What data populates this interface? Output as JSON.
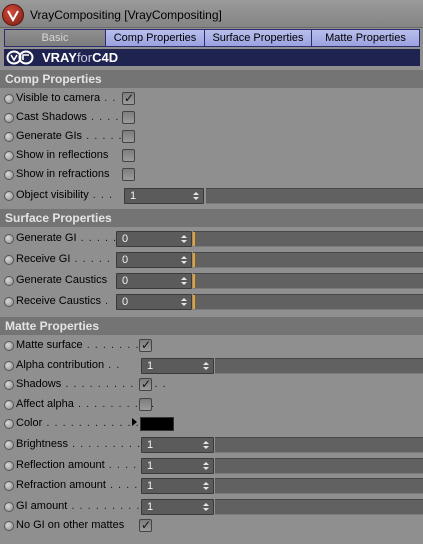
{
  "window": {
    "title": "VrayCompositing [VrayCompositing]"
  },
  "tabs": [
    {
      "label": "Basic",
      "active": true
    },
    {
      "label": "Comp Properties",
      "active": false
    },
    {
      "label": "Surface Properties",
      "active": false
    },
    {
      "label": "Matte Properties",
      "active": false
    }
  ],
  "banner": {
    "brand_main": "VRAY",
    "brand_for": "for",
    "brand_c4d": "C4D"
  },
  "sections": {
    "comp": "Comp Properties",
    "surface": "Surface Properties",
    "matte": "Matte Properties"
  },
  "comp": {
    "visible_to_camera": {
      "label": "Visible to camera",
      "dots": " . .",
      "checked": true
    },
    "cast_shadows": {
      "label": "Cast Shadows",
      "dots": " . . . . .",
      "checked": false
    },
    "generate_gis": {
      "label": "Generate GIs",
      "dots": " . . . . .",
      "checked": false
    },
    "show_in_reflections": {
      "label": "Show in reflections",
      "dots": "",
      "checked": false
    },
    "show_in_refractions": {
      "label": "Show in refractions",
      "dots": "",
      "checked": false
    },
    "object_visibility": {
      "label": "Object visibility",
      "dots": " . . .",
      "value": "1"
    }
  },
  "surface": {
    "generate_gi": {
      "label": "Generate GI",
      "dots": " . . . . .",
      "value": "0"
    },
    "receive_gi": {
      "label": "Receive GI",
      "dots": " . . . . . .",
      "value": "0"
    },
    "generate_caustics": {
      "label": "Generate Caustics",
      "dots": "",
      "value": "0"
    },
    "receive_caustics": {
      "label": "Receive Caustics",
      "dots": " .",
      "value": "0"
    }
  },
  "matte": {
    "matte_surface": {
      "label": "Matte surface",
      "dots": " . . . . . . . .",
      "checked": true
    },
    "alpha_contribution": {
      "label": "Alpha contribution",
      "dots": " . .",
      "value": "1"
    },
    "shadows": {
      "label": "Shadows",
      "dots": " . . . . . . . . . . . . .",
      "checked": true
    },
    "affect_alpha": {
      "label": "Affect alpha",
      "dots": " . . . . . . . . . .",
      "checked": false
    },
    "color": {
      "label": "Color",
      "dots": " . . . . . . . . . . . .",
      "value": "#000000"
    },
    "brightness": {
      "label": "Brightness",
      "dots": " . . . . . . . . . .",
      "value": "1"
    },
    "reflection_amount": {
      "label": "Reflection amount",
      "dots": " . . . .",
      "value": "1"
    },
    "refraction_amount": {
      "label": "Refraction amount",
      "dots": " . . . .",
      "value": "1"
    },
    "gi_amount": {
      "label": "GI amount",
      "dots": " . . . . . . . . . . .",
      "value": "1"
    },
    "no_gi_on_other_mattes": {
      "label": "No GI on other mattes",
      "dots": "",
      "checked": true
    }
  },
  "colors": {
    "tab_accent": "#9aa2e0",
    "banner_bg": "#1f2350",
    "slider_marker": "#f0a020"
  },
  "icons": {
    "app_logo": "vray-logo-icon",
    "check": "checkmark-icon",
    "spin": "spinner-arrows-icon"
  }
}
